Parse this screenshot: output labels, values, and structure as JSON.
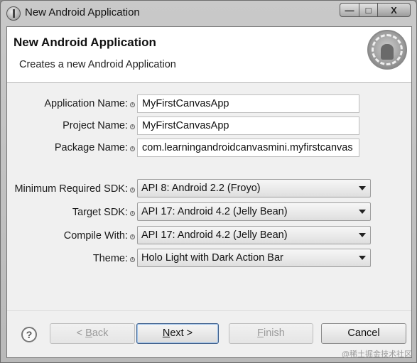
{
  "window": {
    "title": "New Android Application",
    "controls": {
      "minimize": "—",
      "maximize": "□",
      "close": "X"
    }
  },
  "header": {
    "title": "New Android Application",
    "description": "Creates a new Android Application",
    "logo_icon": "android-wizard-logo"
  },
  "form": {
    "application_name": {
      "label": "Application Name:",
      "value": "MyFirstCanvasApp"
    },
    "project_name": {
      "label": "Project Name:",
      "value": "MyFirstCanvasApp"
    },
    "package_name": {
      "label": "Package Name:",
      "value": "com.learningandroidcanvasmini.myfirstcanvas"
    },
    "min_sdk": {
      "label": "Minimum Required SDK:",
      "value": "API 8: Android 2.2 (Froyo)"
    },
    "target_sdk": {
      "label": "Target SDK:",
      "value": "API 17: Android 4.2 (Jelly Bean)"
    },
    "compile_with": {
      "label": "Compile With:",
      "value": "API 17: Android 4.2 (Jelly Bean)"
    },
    "theme": {
      "label": "Theme:",
      "value": "Holo Light with Dark Action Bar"
    },
    "info_glyph": "i"
  },
  "buttons": {
    "help": "?",
    "back_prefix": "< ",
    "back_mnemonic": "B",
    "back_rest": "ack",
    "next_prefix": "",
    "next_mnemonic": "N",
    "next_rest": "ext >",
    "finish_mnemonic": "F",
    "finish_rest": "inish",
    "cancel": "Cancel"
  },
  "watermark": "@稀土掘金技术社区"
}
